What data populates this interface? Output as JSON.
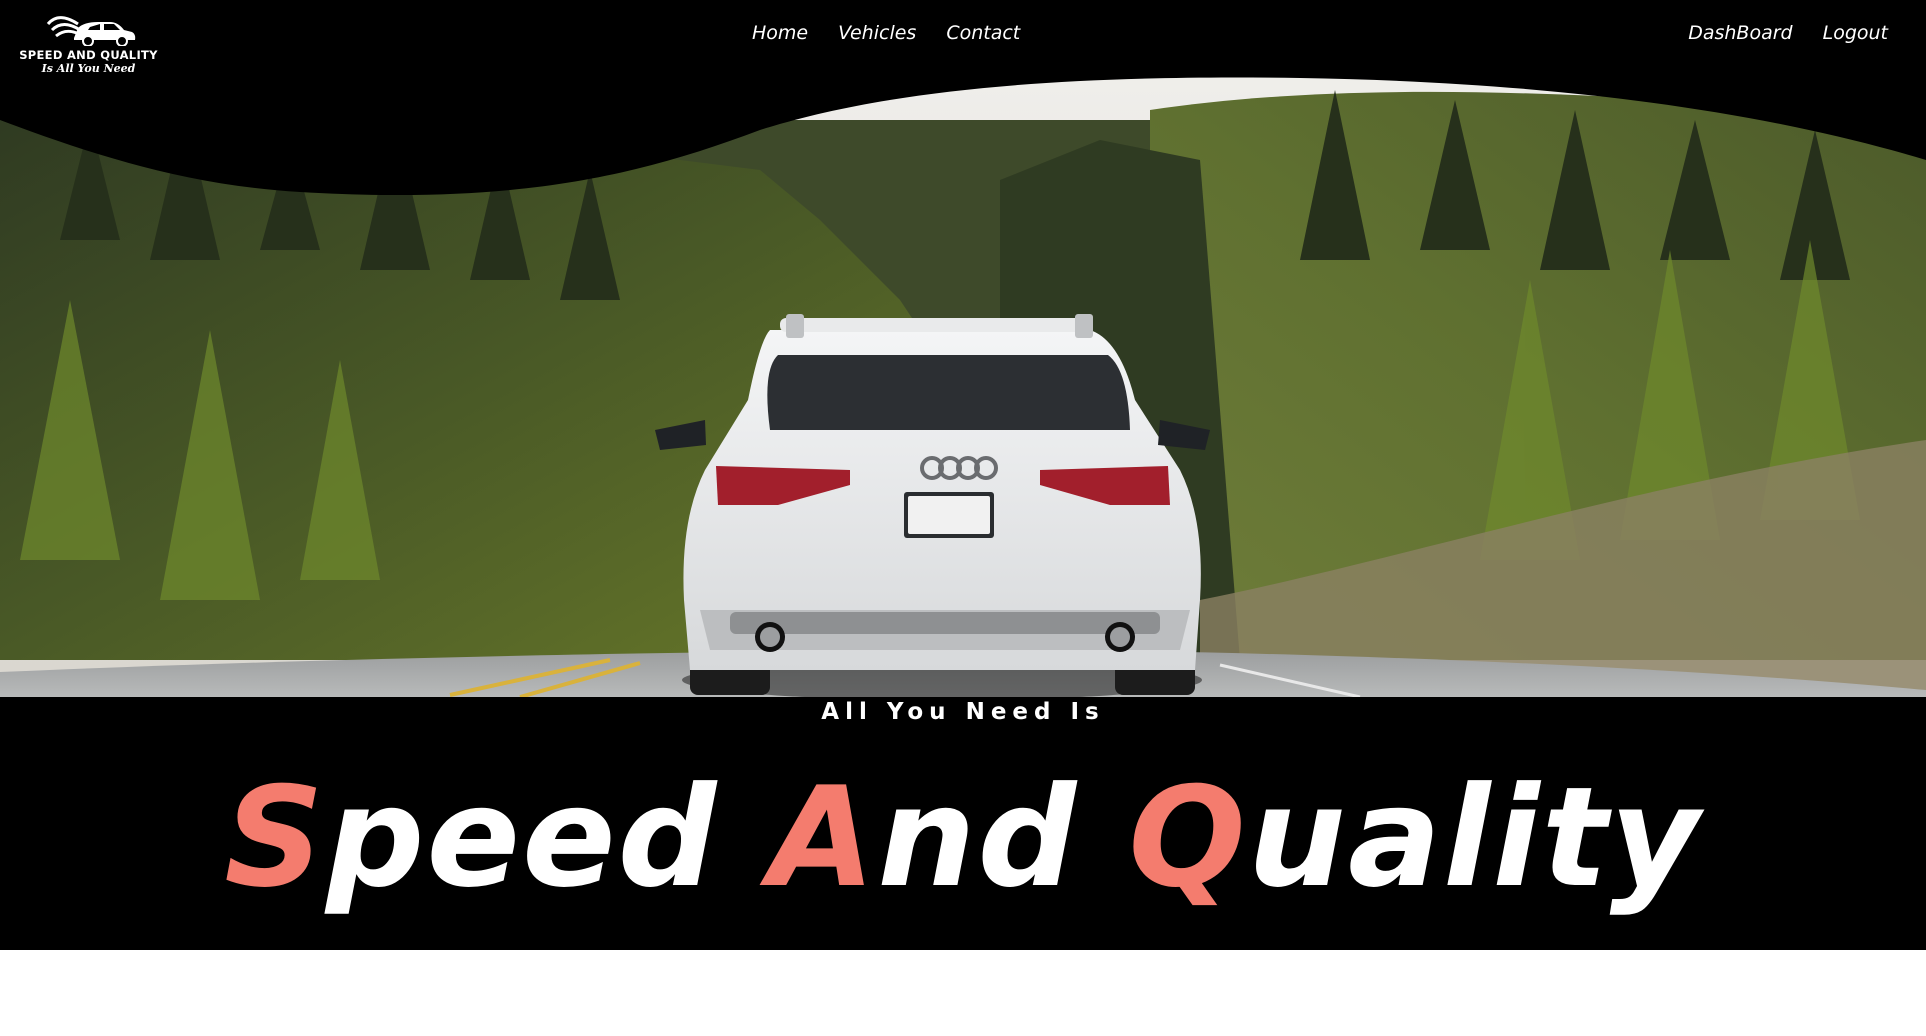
{
  "brand": {
    "name": "SPEED AND QUALITY",
    "tagline": "Is All You Need",
    "logo_icon": "car-icon"
  },
  "nav": {
    "center": [
      "Home",
      "Vehicles",
      "Contact"
    ],
    "right": [
      "DashBoard",
      "Logout"
    ]
  },
  "hero": {
    "image_subject": "white-suv-rear-on-forest-road"
  },
  "headline": {
    "small": "All You Need Is",
    "words": [
      {
        "first": "S",
        "rest": "peed"
      },
      {
        "first": "A",
        "rest": "nd"
      },
      {
        "first": "Q",
        "rest": "uality"
      }
    ]
  },
  "colors": {
    "background": "#000000",
    "accent": "#f47c6e",
    "text": "#ffffff"
  }
}
